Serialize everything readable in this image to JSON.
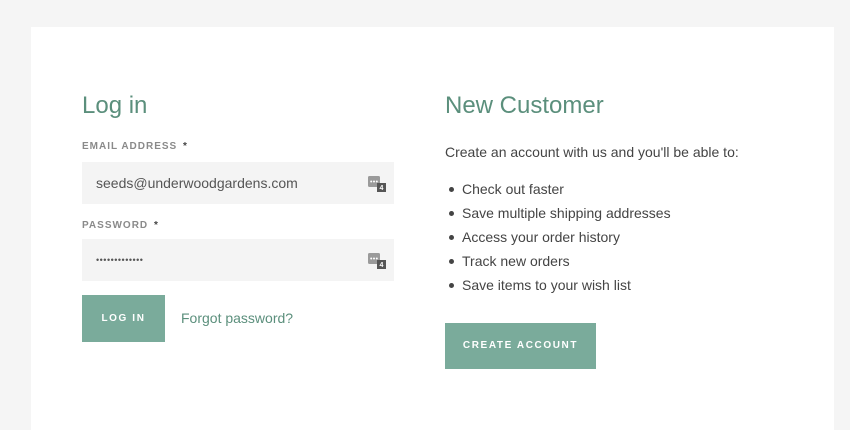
{
  "login": {
    "title": "Log in",
    "email_label": "EMAIL ADDRESS",
    "email_value": "seeds@underwoodgardens.com",
    "password_label": "PASSWORD",
    "password_masked": "•••••••••••••",
    "required_mark": "*",
    "login_button": "LOG IN",
    "forgot_link": "Forgot password?"
  },
  "new_customer": {
    "title": "New Customer",
    "intro": "Create an account with us and you'll be able to:",
    "benefits": [
      "Check out faster",
      "Save multiple shipping addresses",
      "Access your order history",
      "Track new orders",
      "Save items to your wish list"
    ],
    "create_button": "CREATE ACCOUNT"
  },
  "password_manager_badge": "4",
  "colors": {
    "accent": "#5b8f7c",
    "button": "#7aab9b",
    "input_bg": "#f4f4f4",
    "page_bg": "#f5f5f5"
  }
}
